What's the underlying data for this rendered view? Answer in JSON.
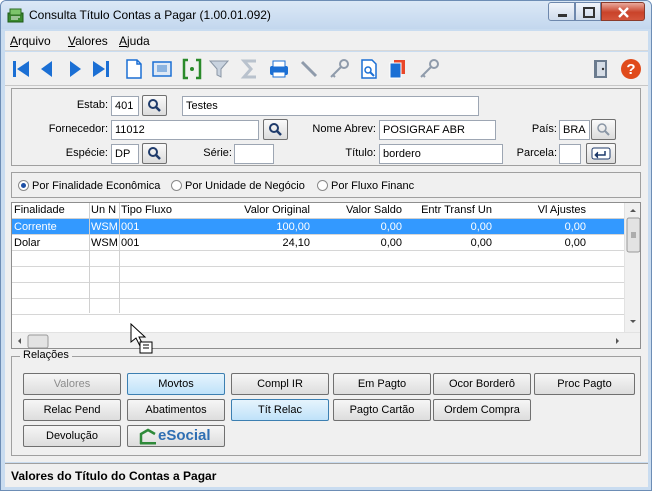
{
  "window": {
    "title": "Consulta Título Contas a Pagar (1.00.01.092)"
  },
  "menu": [
    {
      "mnemonic": "A",
      "rest": "rquivo"
    },
    {
      "mnemonic": "V",
      "rest": "alores"
    },
    {
      "mnemonic": "A",
      "rest": "juda"
    }
  ],
  "toolbar": {
    "icons": [
      "first-icon",
      "prev-icon",
      "next-icon",
      "last-icon",
      "new-doc-icon",
      "screen-icon",
      "brackets-icon",
      "filter-icon",
      "sum-icon",
      "print-icon",
      "pen-icon",
      "key-icon",
      "preview-icon",
      "copy-icon",
      "key2-icon",
      "exit-icon",
      "help-icon"
    ],
    "colors": {
      "nav": "#1b6fd4",
      "help": "#e04a1a"
    }
  },
  "form": {
    "estab_label": "Estab:",
    "estab_value": "401",
    "estab_desc": "Testes",
    "fornecedor_label": "Fornecedor:",
    "fornecedor_value": "11012",
    "nome_abrev_label": "Nome Abrev:",
    "nome_abrev_value": "POSIGRAF ABR",
    "pais_label": "País:",
    "pais_value": "BRA",
    "especie_label": "Espécie:",
    "especie_value": "DP",
    "serie_label": "Série:",
    "serie_value": "",
    "titulo_label": "Título:",
    "titulo_value": "bordero",
    "parcela_label": "Parcela:",
    "parcela_value": ""
  },
  "view_options": {
    "options": [
      "Por Finalidade Econômica",
      "Por Unidade de Negócio",
      "Por Fluxo Financ"
    ],
    "selected_index": 0
  },
  "grid": {
    "columns": [
      "Finalidade",
      "Un N",
      "Tipo Fluxo",
      "Valor Original",
      "Valor Saldo",
      "Entr Transf Un",
      "Vl Ajustes"
    ],
    "rows": [
      {
        "finalidade": "Corrente",
        "un": "WSM",
        "tipo": "001",
        "valor_original": "100,00",
        "valor_saldo": "0,00",
        "entr": "0,00",
        "ajustes": "0,00",
        "selected": true
      },
      {
        "finalidade": "Dolar",
        "un": "WSM",
        "tipo": "001",
        "valor_original": "24,10",
        "valor_saldo": "0,00",
        "entr": "0,00",
        "ajustes": "0,00",
        "selected": false
      }
    ]
  },
  "relacoes": {
    "title": "Relações",
    "row1": [
      "Valores",
      "Movtos",
      "Compl IR",
      "Em Pagto",
      "Ocor Borderô",
      "Proc Pagto"
    ],
    "row2": [
      "Relac Pend",
      "Abatimentos",
      "Tít Relac",
      "Pagto Cartão",
      "Ordem Compra"
    ],
    "row3": [
      "Devolução"
    ],
    "esocial_label": "eSocial"
  },
  "status_text": "Valores do Título do Contas a Pagar"
}
